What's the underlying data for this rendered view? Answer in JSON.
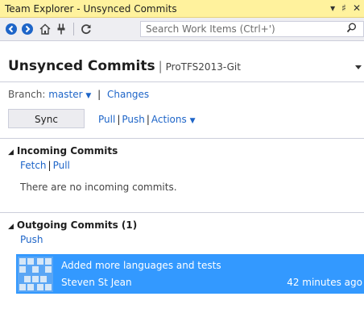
{
  "window": {
    "title": "Team Explorer - Unsynced Commits",
    "controls": {
      "dropdown": "▾",
      "pin": "♯",
      "close": "✕"
    }
  },
  "toolbar": {
    "icons": [
      "back-icon",
      "forward-icon",
      "home-icon",
      "connect-icon",
      "refresh-icon"
    ],
    "search_placeholder": "Search Work Items (Ctrl+')"
  },
  "header": {
    "title": "Unsynced Commits",
    "separator": "|",
    "project": "ProTFS2013-Git"
  },
  "branch": {
    "label": "Branch:",
    "value": "master",
    "separator": "|",
    "changes_link": "Changes"
  },
  "actions": {
    "sync_label": "Sync",
    "pull_label": "Pull",
    "push_label": "Push",
    "actions_label": "Actions",
    "separator": "|"
  },
  "incoming": {
    "title": "Incoming Commits",
    "fetch_label": "Fetch",
    "pull_label": "Pull",
    "separator": "|",
    "empty_message": "There are no incoming commits."
  },
  "outgoing": {
    "title": "Outgoing Commits (1)",
    "push_label": "Push",
    "commits": [
      {
        "message": "Added more languages and tests",
        "author": "Steven St Jean",
        "time": "42 minutes ago"
      }
    ]
  },
  "colors": {
    "title_bar": "#fff29d",
    "link": "#1e65c8",
    "selection": "#3399ff"
  }
}
